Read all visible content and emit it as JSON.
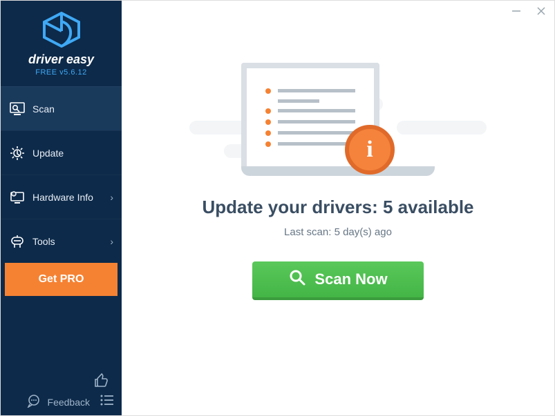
{
  "app": {
    "name": "driver easy",
    "version_line": "FREE v5.6.12"
  },
  "sidebar": {
    "items": [
      {
        "label": "Scan",
        "icon": "scan-monitor-icon",
        "has_submenu": false
      },
      {
        "label": "Update",
        "icon": "update-gear-icon",
        "has_submenu": false
      },
      {
        "label": "Hardware Info",
        "icon": "hardware-info-icon",
        "has_submenu": true
      },
      {
        "label": "Tools",
        "icon": "tools-icon",
        "has_submenu": true
      }
    ],
    "get_pro_label": "Get PRO",
    "feedback_label": "Feedback"
  },
  "main": {
    "headline": "Update your drivers: 5 available",
    "subline": "Last scan: 5 day(s) ago",
    "scan_button_label": "Scan Now",
    "info_badge_letter": "i"
  }
}
